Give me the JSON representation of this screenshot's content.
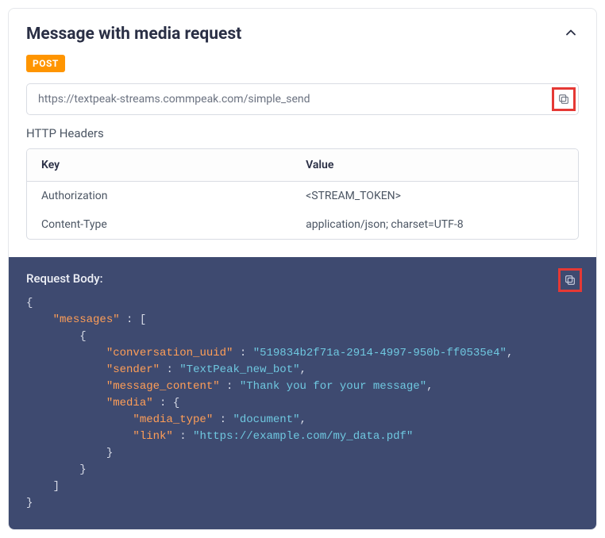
{
  "title": "Message with media request",
  "method_badge": "POST",
  "url": "https://textpeak-streams.commpeak.com/simple_send",
  "headers_heading": "HTTP Headers",
  "headers_table": {
    "columns": [
      "Key",
      "Value"
    ],
    "rows": [
      {
        "key": "Authorization",
        "value": "<STREAM_TOKEN>"
      },
      {
        "key": "Content-Type",
        "value": "application/json; charset=UTF-8"
      }
    ]
  },
  "body_title": "Request Body:",
  "body": {
    "messages_key": "\"messages\"",
    "open_bracket": "[",
    "open_brace": "{",
    "conversation_uuid_key": "\"conversation_uuid\"",
    "conversation_uuid_val": "\"519834b2f71a-2914-4997-950b-ff0535e4\"",
    "sender_key": "\"sender\"",
    "sender_val": "\"TextPeak_new_bot\"",
    "message_content_key": "\"message_content\"",
    "message_content_val": "\"Thank you for your message\"",
    "media_key": "\"media\"",
    "media_type_key": "\"media_type\"",
    "media_type_val": "\"document\"",
    "link_key": "\"link\"",
    "link_val": "\"https://example.com/my_data.pdf\"",
    "close_brace": "}",
    "close_bracket": "]",
    "colon": " : ",
    "comma": ","
  }
}
